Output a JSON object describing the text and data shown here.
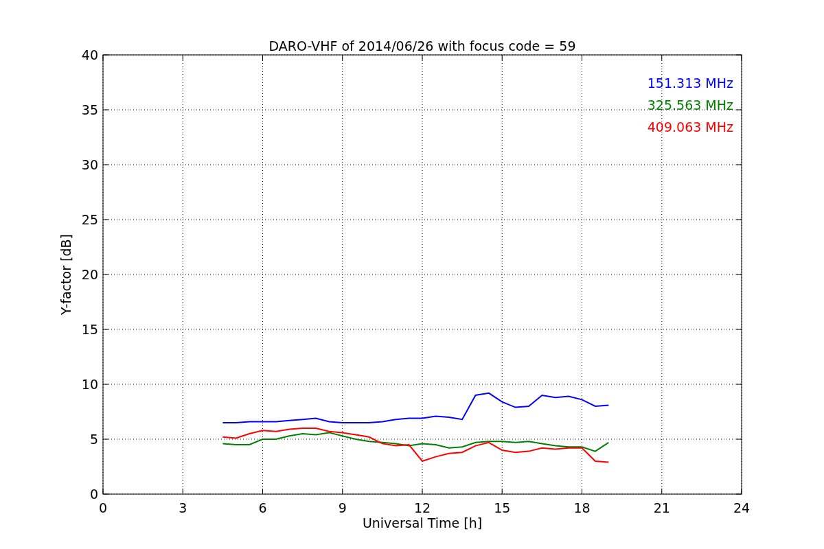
{
  "chart_data": {
    "type": "line",
    "title": "DARO-VHF of 2014/06/26 with focus code = 59",
    "xlabel": "Universal Time [h]",
    "ylabel": "Y-factor [dB]",
    "x": [
      4.5,
      5,
      5.5,
      6,
      6.5,
      7,
      7.5,
      8,
      8.5,
      9,
      9.5,
      10,
      10.5,
      11,
      11.5,
      12,
      12.5,
      13,
      13.5,
      14,
      14.5,
      15,
      15.5,
      16,
      16.5,
      17,
      17.5,
      18,
      18.5,
      19
    ],
    "series": [
      {
        "name": "151.313 MHz",
        "color": "#0000ff",
        "values": [
          6.5,
          6.5,
          6.6,
          6.6,
          6.6,
          6.7,
          6.8,
          6.9,
          6.6,
          6.5,
          6.5,
          6.5,
          6.6,
          6.8,
          6.9,
          6.9,
          7.1,
          7.0,
          6.8,
          9.0,
          9.2,
          8.4,
          7.9,
          8.0,
          9.0,
          8.8,
          8.9,
          8.6,
          8.0,
          8.1
        ]
      },
      {
        "name": "325.563 MHz",
        "color": "#008000",
        "values": [
          4.6,
          4.5,
          4.5,
          5.0,
          5.0,
          5.3,
          5.5,
          5.4,
          5.6,
          5.3,
          5.0,
          4.8,
          4.7,
          4.6,
          4.4,
          4.6,
          4.5,
          4.2,
          4.3,
          4.7,
          4.8,
          4.8,
          4.7,
          4.8,
          4.6,
          4.4,
          4.3,
          4.3,
          3.9,
          4.7
        ]
      },
      {
        "name": "409.063 MHz",
        "color": "#ff0000",
        "values": [
          5.2,
          5.1,
          5.5,
          5.8,
          5.7,
          5.9,
          6.0,
          6.0,
          5.7,
          5.6,
          5.4,
          5.2,
          4.6,
          4.4,
          4.5,
          3.0,
          3.4,
          3.7,
          3.8,
          4.4,
          4.7,
          4.0,
          3.8,
          3.9,
          4.2,
          4.1,
          4.2,
          4.2,
          3.0,
          2.9
        ]
      }
    ],
    "grid": true,
    "xlim": [
      0,
      24
    ],
    "ylim": [
      0,
      40
    ],
    "xticks": [
      0,
      3,
      6,
      9,
      12,
      15,
      18,
      21,
      24
    ],
    "yticks": [
      0,
      5,
      10,
      15,
      20,
      25,
      30,
      35,
      40
    ]
  }
}
